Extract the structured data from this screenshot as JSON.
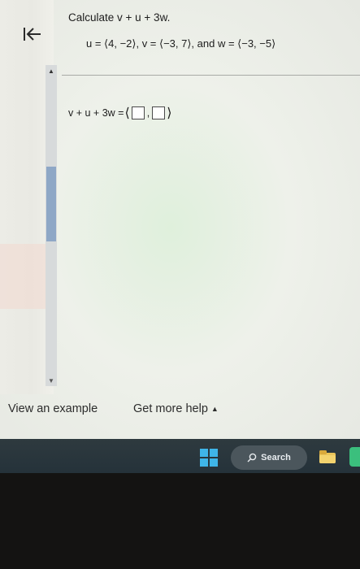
{
  "question": {
    "title": "Calculate v + u + 3w.",
    "given": "u = ⟨4, −2⟩, v = ⟨−3, 7⟩, and w = ⟨−3, −5⟩",
    "answer_label": "v + u + 3w =",
    "open_bracket": "⟨",
    "separator": ",",
    "close_bracket": "⟩"
  },
  "footer": {
    "example_label": "View an example",
    "help_label": "Get more help",
    "help_caret": "▲"
  },
  "taskbar": {
    "search_label": "Search"
  },
  "colors": {
    "accent_scroll": "#8ea7c6",
    "taskbar": "#2e3a3f",
    "windows_blue": "#3fb5e8"
  }
}
